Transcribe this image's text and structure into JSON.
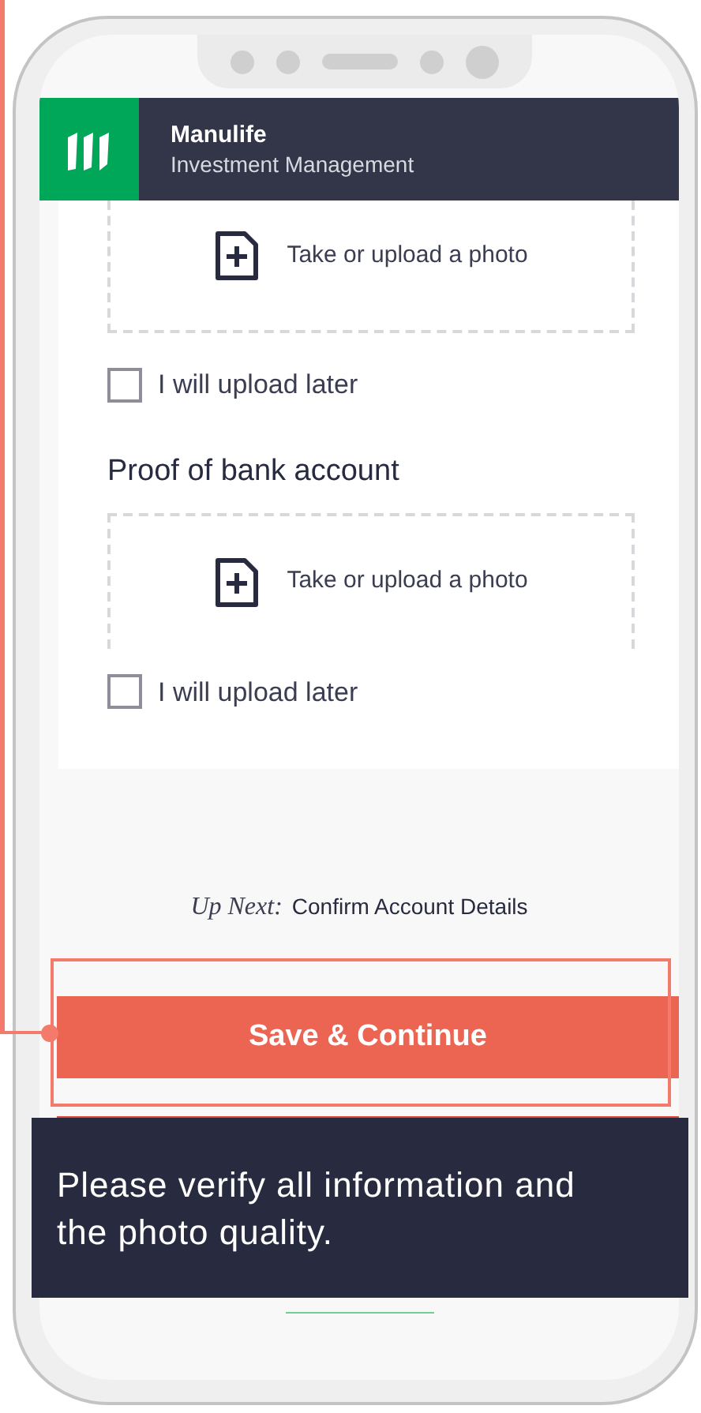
{
  "header": {
    "brand": "Manulife",
    "subtitle": "Investment Management"
  },
  "sections": [
    {
      "upload_label": "Take or upload a photo",
      "checkbox": {
        "label": "I will upload later",
        "checked": false
      }
    },
    {
      "title": "Proof of bank account",
      "upload_label": "Take or upload a photo",
      "checkbox": {
        "label": "I will upload later",
        "checked": false
      }
    }
  ],
  "up_next": {
    "label": "Up Next:",
    "value": "Confirm Account Details"
  },
  "primary_button": "Save & Continue",
  "tooltip": "Please verify all information and the photo quality."
}
